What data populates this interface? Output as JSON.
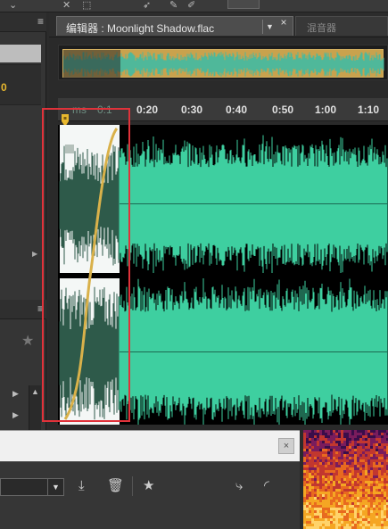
{
  "editor": {
    "tab_label": "编辑器 : Moonlight Shadow.flac",
    "tab_close": "×",
    "tab_dropdown": "▼",
    "mixer_tab_label": "混音器"
  },
  "timeline": {
    "ruler_labels": [
      "ms",
      "0:1",
      "0:20",
      "0:30",
      "0:40",
      "0:50",
      "1:00",
      "1:10"
    ]
  },
  "left_dock": {
    "files_marker": "0",
    "panel_menu_icon": "≡"
  },
  "bottom_panel": {
    "close_label": "×"
  },
  "colors": {
    "waveform": "#3ecfa0",
    "waveform_faded": "#2e5a4a",
    "fade_curve": "#d9b14a",
    "selection_outline": "#e0323a",
    "files_marker": "#e8b82e"
  },
  "icons": [
    "panel-menu-icon",
    "star-icon",
    "download-icon",
    "trash-icon",
    "star-icon",
    "merge-icon",
    "curve-icon",
    "playhead-marker-icon",
    "dropdown-arrow-icon",
    "close-icon"
  ]
}
